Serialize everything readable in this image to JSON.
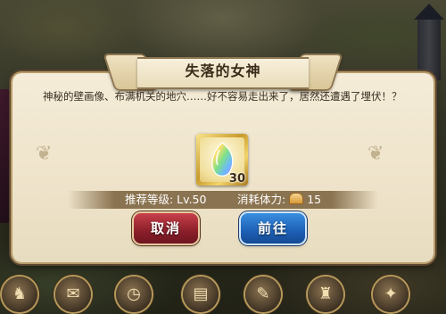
{
  "dialog": {
    "title": "失落的女神",
    "description": "神秘的壁画像、布满机关的地穴……好不容易走出来了，居然还遭遇了埋伏！？",
    "item": {
      "icon": "rainbow-crystal-icon",
      "count": "30"
    },
    "required_level_text": "推荐等级: Lv.50",
    "stamina_label": "消耗体力:",
    "stamina_icon": "bread-icon",
    "stamina_value": "15",
    "cancel_label": "取消",
    "go_label": "前往"
  },
  "colors": {
    "cancel_button": "#8a1f2a",
    "go_button": "#1c5fb4",
    "panel": "#f1e7cf",
    "item_frame": "#d9aa3a"
  },
  "menu_bar": {
    "items": [
      {
        "icon": "character-portrait-icon"
      },
      {
        "icon": "scroll-icon"
      },
      {
        "icon": "pocket-watch-icon"
      },
      {
        "icon": "book-icon"
      },
      {
        "icon": "mail-icon"
      },
      {
        "icon": "bag-icon"
      },
      {
        "icon": "gear-icon"
      }
    ]
  }
}
